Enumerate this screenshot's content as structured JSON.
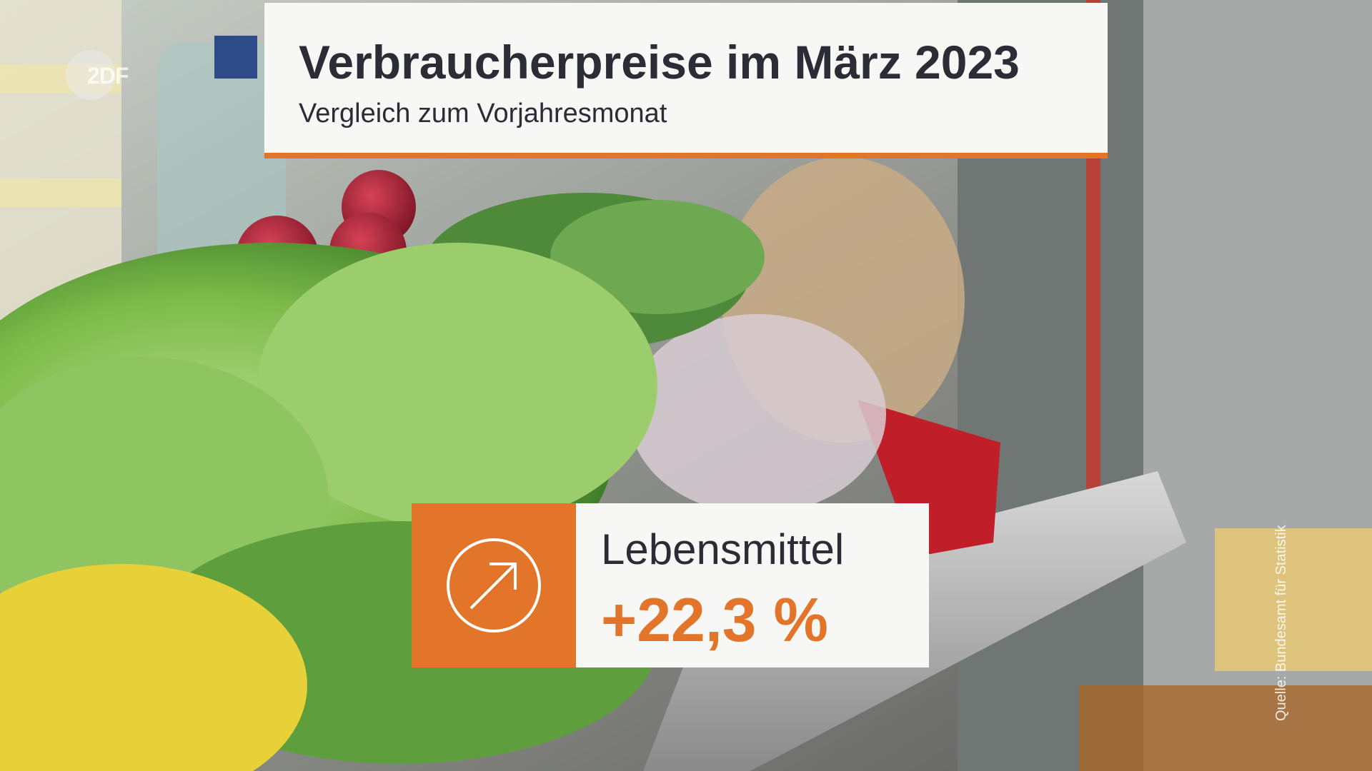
{
  "broadcaster": {
    "logo_text": "2DF"
  },
  "title_card": {
    "title": "Verbraucherpreise im März 2023",
    "subtitle": "Vergleich zum Vorjahresmonat"
  },
  "stat": {
    "label": "Lebensmittel",
    "value": "+22,3 %",
    "icon": "arrow-up-right-circle-icon"
  },
  "source": "Quelle: Bundesamt für Statistik",
  "colors": {
    "accent": "#e2752a",
    "card_bg": "#f7f7f5",
    "text_dark": "#2c2c36"
  }
}
